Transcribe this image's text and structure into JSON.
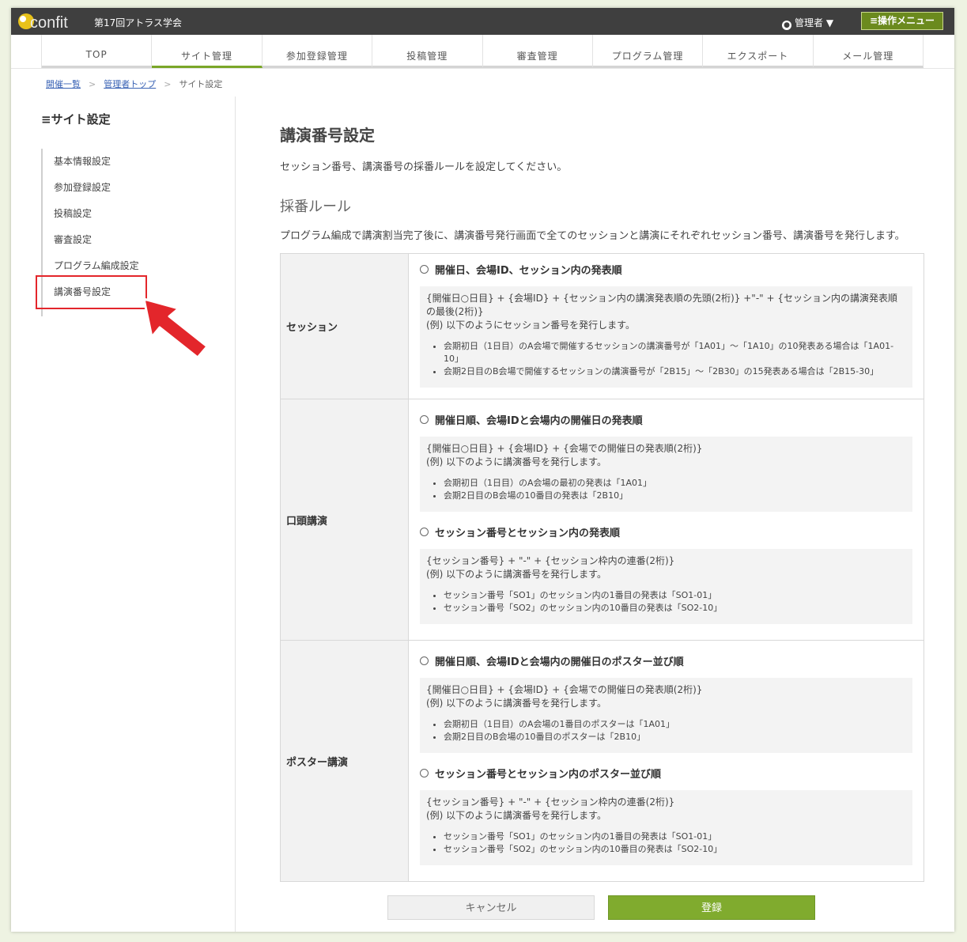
{
  "brand": "confit",
  "header": {
    "conference_title": "第17回アトラス学会",
    "admin_label": "管理者 ▼",
    "op_menu_label": "≡操作メニュー"
  },
  "nav": {
    "tabs": [
      {
        "label": "TOP"
      },
      {
        "label": "サイト管理"
      },
      {
        "label": "参加登録管理"
      },
      {
        "label": "投稿管理"
      },
      {
        "label": "審査管理"
      },
      {
        "label": "プログラム管理"
      },
      {
        "label": "エクスポート"
      },
      {
        "label": "メール管理"
      }
    ],
    "active_index": 1,
    "accent_color": "#7aa628"
  },
  "breadcrumb": {
    "items": [
      "開催一覧",
      "管理者トップ",
      "サイト設定"
    ]
  },
  "sidebar": {
    "title": "≡サイト設定",
    "items": [
      {
        "label": "基本情報設定"
      },
      {
        "label": "参加登録設定"
      },
      {
        "label": "投稿設定"
      },
      {
        "label": "審査設定"
      },
      {
        "label": "プログラム編成設定"
      },
      {
        "label": "講演番号設定"
      }
    ]
  },
  "main": {
    "page_title": "講演番号設定",
    "description": "セッション番号、講演番号の採番ルールを設定してください。",
    "section_title": "採番ルール",
    "section_description": "プログラム編成で講演割当完了後に、講演番号発行画面で全てのセッションと講演にそれぞれセッション番号、講演番号を発行します。",
    "rows": [
      {
        "label": "セッション",
        "options": [
          {
            "title": "開催日、会場ID、セッション内の発表順",
            "formula": "{開催日○日目} + {会場ID} + {セッション内の講演発表順の先頭(2桁)} +\"-\" + {セッション内の講演発表順の最後(2桁)}",
            "note": "(例) 以下のようにセッション番号を発行します。",
            "examples": [
              "会期初日（1日目）のA会場で開催するセッションの講演番号が「1A01」～「1A10」の10発表ある場合は「1A01-10」",
              "会期2日目のB会場で開催するセッションの講演番号が「2B15」～「2B30」の15発表ある場合は「2B15-30」"
            ]
          }
        ]
      },
      {
        "label": "口頭講演",
        "options": [
          {
            "title": "開催日順、会場IDと会場内の開催日の発表順",
            "formula": "{開催日○日目} + {会場ID} + {会場での開催日の発表順(2桁)}",
            "note": "(例) 以下のように講演番号を発行します。",
            "examples": [
              "会期初日（1日目）のA会場の最初の発表は「1A01」",
              "会期2日目のB会場の10番目の発表は「2B10」"
            ]
          },
          {
            "title": "セッション番号とセッション内の発表順",
            "formula": "{セッション番号} + \"-\" + {セッション枠内の連番(2桁)}",
            "note": "(例) 以下のように講演番号を発行します。",
            "examples": [
              "セッション番号「SO1」のセッション内の1番目の発表は「SO1-01」",
              "セッション番号「SO2」のセッション内の10番目の発表は「SO2-10」"
            ]
          }
        ]
      },
      {
        "label": "ポスター講演",
        "options": [
          {
            "title": "開催日順、会場IDと会場内の開催日のポスター並び順",
            "formula": "{開催日○日目} + {会場ID} + {会場での開催日の発表順(2桁)}",
            "note": "(例) 以下のように講演番号を発行します。",
            "examples": [
              "会期初日（1日目）のA会場の1番目のポスターは「1A01」",
              "会期2日目のB会場の10番目のポスターは「2B10」"
            ]
          },
          {
            "title": "セッション番号とセッション内のポスター並び順",
            "formula": "{セッション番号} + \"-\" + {セッション枠内の連番(2桁)}",
            "note": "(例) 以下のように講演番号を発行します。",
            "examples": [
              "セッション番号「SO1」のセッション内の1番目の発表は「SO1-01」",
              "セッション番号「SO2」のセッション内の10番目の発表は「SO2-10」"
            ]
          }
        ]
      }
    ]
  },
  "buttons": {
    "cancel_label": "キャンセル",
    "submit_label": "登録"
  }
}
